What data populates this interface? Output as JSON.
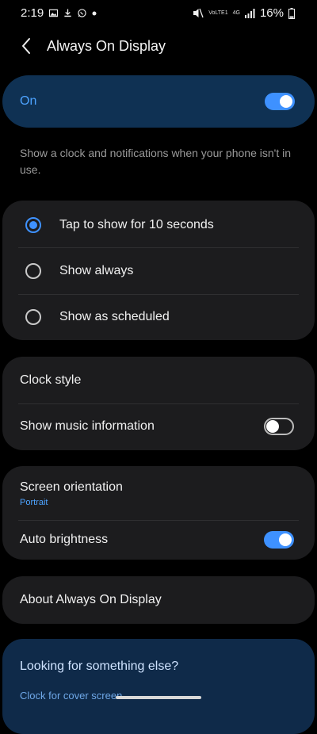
{
  "status_bar": {
    "time": "2:19",
    "battery": "16%",
    "volte_label": "VoLTE1",
    "network_label": "4G"
  },
  "header": {
    "title": "Always On Display"
  },
  "master_toggle": {
    "label": "On",
    "state": true
  },
  "description": "Show a clock and notifications when your phone isn't in use.",
  "display_mode": {
    "options": [
      {
        "label": "Tap to show for 10 seconds",
        "selected": true
      },
      {
        "label": "Show always",
        "selected": false
      },
      {
        "label": "Show as scheduled",
        "selected": false
      }
    ]
  },
  "clock_group": {
    "clock_style": "Clock style",
    "music_info": {
      "label": "Show music information",
      "state": false
    }
  },
  "display_group": {
    "orientation": {
      "label": "Screen orientation",
      "value": "Portrait"
    },
    "auto_brightness": {
      "label": "Auto brightness",
      "state": true
    }
  },
  "about": {
    "label": "About Always On Display"
  },
  "search_suggestion": {
    "title": "Looking for something else?",
    "link": "Clock for cover screen"
  },
  "colors": {
    "accent": "#3e91ff",
    "card_bg": "#1c1c1e",
    "master_bg": "#0f3153",
    "search_bg": "#0f2a49"
  }
}
